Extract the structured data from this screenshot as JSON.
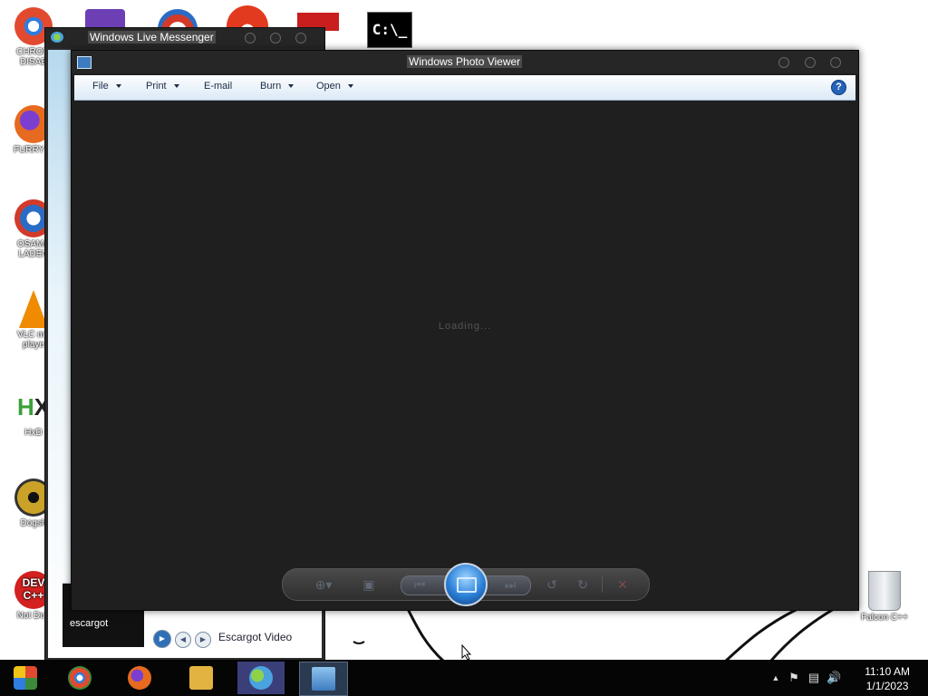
{
  "desktop": {
    "icons_left": [
      {
        "label": "CHROM\nDISAB",
        "color": "#2f7de1"
      },
      {
        "label": "FURRY C",
        "color": "#e66a1f"
      },
      {
        "label": "OSAMA\nLADEN",
        "color": "#2a6cc4"
      },
      {
        "label": "VLC me\nplaye",
        "color": "#f08a00"
      },
      {
        "label": "HxD",
        "color": "#3aa03a"
      },
      {
        "label": "Dogsh",
        "color": "#c9a227"
      },
      {
        "label": "Not Dog",
        "color": "#d32020"
      }
    ],
    "icons_top": [
      {
        "name": "visual-studio-icon",
        "color": "#6c3fb5"
      },
      {
        "name": "app-globe-icon",
        "color": "#d33a2a"
      },
      {
        "name": "app-p-icon",
        "color": "#e23a1e"
      },
      {
        "name": "app-yen-icon",
        "color": "#c81e1e"
      },
      {
        "name": "cmd-icon",
        "text": "C:\\_"
      }
    ],
    "icon_right": {
      "label": "Falcon C++"
    }
  },
  "messenger": {
    "title": "Windows Live Messenger",
    "thumb_text": "escargot",
    "video_label": "Escargot Video"
  },
  "photo_viewer": {
    "title": "Windows Photo Viewer",
    "menu": [
      {
        "label": "File",
        "has_caret": true
      },
      {
        "label": "Print",
        "has_caret": true
      },
      {
        "label": "E-mail",
        "has_caret": false
      },
      {
        "label": "Burn",
        "has_caret": true
      },
      {
        "label": "Open",
        "has_caret": true
      }
    ],
    "help_label": "?",
    "loading_text": "Loading..."
  },
  "taskbar": {
    "clock_time": "11:10 AM",
    "clock_date": "1/1/2023",
    "apps": [
      {
        "name": "start-orb-icon",
        "color": "#3b8a3a"
      },
      {
        "name": "chrome-icon",
        "color": "#2f7de1"
      },
      {
        "name": "firefox-icon",
        "color": "#e66a1f"
      },
      {
        "name": "explorer-icon",
        "color": "#e3b341"
      },
      {
        "name": "messenger-icon",
        "color": "#4aa3df"
      },
      {
        "name": "photo-viewer-icon",
        "color": "#5aa0d8"
      }
    ]
  }
}
